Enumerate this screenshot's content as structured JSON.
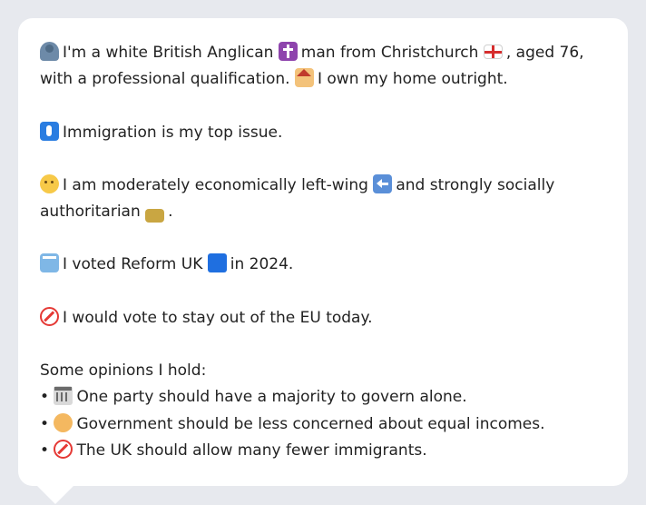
{
  "profile": {
    "paragraphs": [
      {
        "icon": "person-icon",
        "text": "I'm a white British Anglican",
        "mid_icon": "latin-cross-icon",
        "text2": "man from Christchurch",
        "end_icon": "england-flag-icon",
        "text3": ", aged 76, with a professional qualification.",
        "icon4": "house-icon",
        "text4": "I own my home outright."
      },
      {
        "icon": "immigration-icon",
        "text": "Immigration is my top issue."
      },
      {
        "icon": "thinking-face-icon",
        "text": "I am moderately economically left-wing",
        "mid_icon": "left-arrow-icon",
        "text2": "and strongly socially authoritarian",
        "end_icon": "lock-icon",
        "text3": "."
      },
      {
        "icon": "ballot-box-icon",
        "text": "I voted Reform UK",
        "mid_icon": "blue-square-icon",
        "text2": "in 2024."
      },
      {
        "icon": "no-entry-icon",
        "text": "I would vote to stay out of the EU today."
      }
    ],
    "opinions_heading": "Some opinions I hold:",
    "bullet_char": "•",
    "opinions": [
      {
        "icon": "classical-building-icon",
        "text": "One party should have a majority to govern alone."
      },
      {
        "icon": "juggling-icon",
        "text": "Government should be less concerned about equal incomes."
      },
      {
        "icon": "no-entry-icon",
        "text": "The UK should allow many fewer immigrants."
      }
    ]
  },
  "colors": {
    "background": "#e7e9ee",
    "card": "#ffffff",
    "text": "#222222"
  }
}
